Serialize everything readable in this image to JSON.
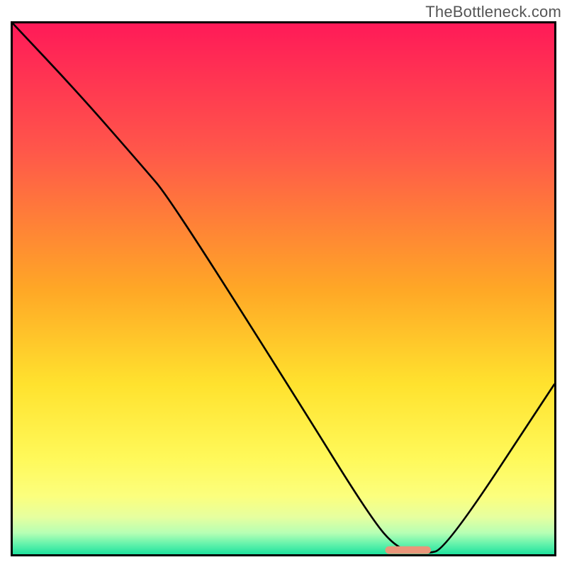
{
  "watermark": "TheBottleneck.com",
  "chart_data": {
    "type": "line",
    "title": "",
    "xlabel": "",
    "ylabel": "",
    "xlim": [
      0,
      100
    ],
    "ylim": [
      0,
      100
    ],
    "grid": false,
    "legend": false,
    "annotations": [],
    "background_gradient_stops": [
      {
        "pos": 0,
        "color": "#ff1a58"
      },
      {
        "pos": 24,
        "color": "#ff574a"
      },
      {
        "pos": 50,
        "color": "#ffa726"
      },
      {
        "pos": 68,
        "color": "#ffe22e"
      },
      {
        "pos": 82,
        "color": "#fff95a"
      },
      {
        "pos": 89,
        "color": "#fcff7d"
      },
      {
        "pos": 93,
        "color": "#e6ff9f"
      },
      {
        "pos": 96,
        "color": "#b6ffb4"
      },
      {
        "pos": 98,
        "color": "#67f3ac"
      },
      {
        "pos": 100,
        "color": "#1fe29e"
      }
    ],
    "series": [
      {
        "name": "bottleneck-curve",
        "color": "#000000",
        "x": [
          0,
          12,
          24,
          29,
          52,
          66,
          71,
          76,
          80,
          100
        ],
        "values": [
          100,
          87,
          73,
          67,
          30,
          7,
          1,
          0,
          1,
          32
        ]
      }
    ],
    "marker": {
      "name": "optimal-zone-marker",
      "x_center": 73,
      "width": 7,
      "color": "#e9967a",
      "thickness_px": 11
    }
  }
}
